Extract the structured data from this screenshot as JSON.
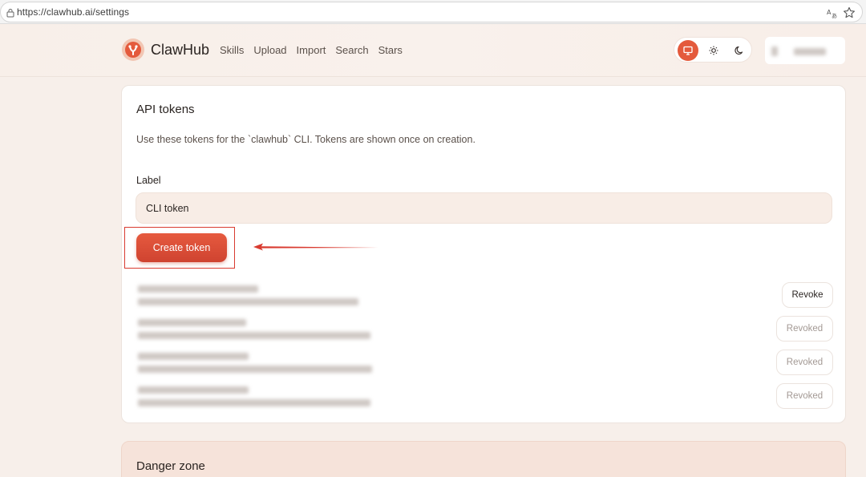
{
  "browser": {
    "url": "https://clawhub.ai/settings"
  },
  "header": {
    "brand": "ClawHub",
    "nav": [
      "Skills",
      "Upload",
      "Import",
      "Search",
      "Stars"
    ],
    "theme_options": [
      "monitor-icon",
      "sun-icon",
      "moon-icon"
    ],
    "theme_selected": "monitor"
  },
  "api_tokens": {
    "title": "API tokens",
    "description": "Use these tokens for the `clawhub` CLI. Tokens are shown once on creation.",
    "label_field": {
      "label": "Label",
      "value": "CLI token"
    },
    "create_button": "Create token",
    "tokens": [
      {
        "action": "Revoke",
        "state": "active"
      },
      {
        "action": "Revoked",
        "state": "revoked"
      },
      {
        "action": "Revoked",
        "state": "revoked"
      },
      {
        "action": "Revoked",
        "state": "revoked"
      }
    ]
  },
  "danger_zone": {
    "title": "Danger zone"
  },
  "colors": {
    "accent": "#e45a3c",
    "annotation_red": "#d93b30",
    "page_bg": "#f7efea"
  }
}
